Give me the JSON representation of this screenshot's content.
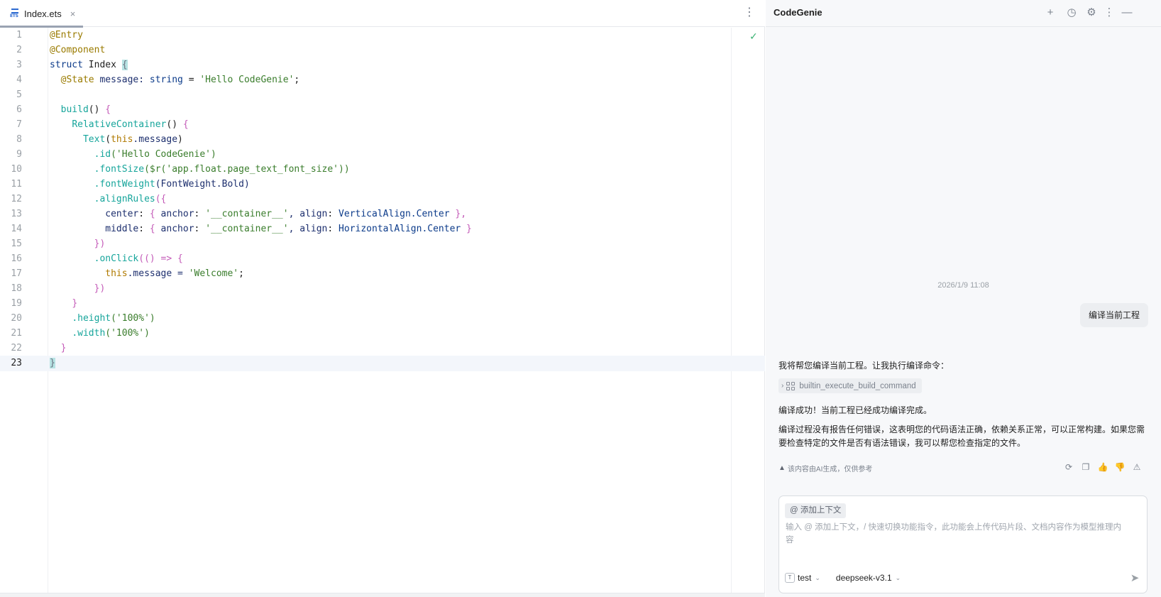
{
  "editor": {
    "tab": {
      "name": "Index.ets",
      "close": "×",
      "icon_label": "ETS"
    },
    "menu_icon": "⋮",
    "status_icon": "✓",
    "lines": [
      {
        "n": "1"
      },
      {
        "n": "2"
      },
      {
        "n": "3"
      },
      {
        "n": "4"
      },
      {
        "n": "5"
      },
      {
        "n": "6"
      },
      {
        "n": "7"
      },
      {
        "n": "8"
      },
      {
        "n": "9"
      },
      {
        "n": "10"
      },
      {
        "n": "11"
      },
      {
        "n": "12"
      },
      {
        "n": "13"
      },
      {
        "n": "14"
      },
      {
        "n": "15"
      },
      {
        "n": "16"
      },
      {
        "n": "17"
      },
      {
        "n": "18"
      },
      {
        "n": "19"
      },
      {
        "n": "20"
      },
      {
        "n": "21"
      },
      {
        "n": "22"
      },
      {
        "n": "23"
      }
    ],
    "code": {
      "l1": "@Entry",
      "l2": "@Component",
      "l3_kw": "struct",
      "l3_name": " Index ",
      "l3_brace": "{",
      "l4_ann": "@State",
      "l4_rest": " message: ",
      "l4_type": "string",
      "l4_eq": " = ",
      "l4_str": "'Hello CodeGenie'",
      "l4_end": ";",
      "l6_fn": "build",
      "l6_paren": "()",
      "l6_brace": " {",
      "l7_fn": "RelativeContainer",
      "l7_paren": "()",
      "l7_brace": " {",
      "l8_fn": "Text",
      "l8_open": "(",
      "l8_this": "this",
      "l8_rest": ".message",
      "l8_close": ")",
      "l9_fn": ".id",
      "l9_str": "('Hello CodeGenie')",
      "l10_fn": ".fontSize",
      "l10_arg": "($r('app.float.page_text_font_size'))",
      "l11_fn": ".fontWeight",
      "l11_arg": "(FontWeight.Bold)",
      "l12_fn": ".alignRules",
      "l12_arg": "({",
      "l13_a": "center",
      "l13_b": ": ",
      "l13_c": "{",
      "l13_d": " anchor",
      "l13_e": ": ",
      "l13_f": "'__container__'",
      "l13_g": ", align",
      "l13_h": ": ",
      "l13_i": "VerticalAlign.Center",
      "l13_j": " },",
      "l14_a": "middle",
      "l14_b": ": ",
      "l14_c": "{",
      "l14_d": " anchor",
      "l14_e": ": ",
      "l14_f": "'__container__'",
      "l14_g": ", align",
      "l14_h": ": ",
      "l14_i": "HorizontalAlign.Center",
      "l14_j": " }",
      "l15": "})",
      "l16_fn": ".onClick",
      "l16_arg": "(() => {",
      "l17_this": "this",
      "l17_rest": ".message = ",
      "l17_str": "'Welcome'",
      "l17_end": ";",
      "l18": "})",
      "l19": "}",
      "l20_fn": ".height",
      "l20_arg": "('100%')",
      "l21_fn": ".width",
      "l21_arg": "('100%')",
      "l22": "}",
      "l23": "}"
    }
  },
  "chat": {
    "title": "CodeGenie",
    "header_icons": {
      "new": "+",
      "history": "◷",
      "settings": "⚙",
      "more": "⋮",
      "minimize": "—"
    },
    "timestamp": "2026/1/9 11:08",
    "user_message": "编译当前工程",
    "ai_intro": "我将帮您编译当前工程。让我执行编译命令：",
    "tool_call": "builtin_execute_build_command",
    "ai_result": "编译成功！当前工程已经成功编译完成。",
    "ai_detail_1": "编译过程没有报告任何错误，这表明您的代码语法正确，依赖关系正常，可以正常构建。如果您需",
    "ai_detail_2": "要检查特定的文件是否有语法错误，我可以帮您检查指定的文件。",
    "disclaimer": "该内容由AI生成，仅供参考",
    "actions": {
      "regenerate": "⟳",
      "copy": "❐",
      "like": "👍",
      "dislike": "👎",
      "report": "⚠"
    },
    "composer": {
      "context_chip": "@ 添加上下文",
      "placeholder_1": "输入 @ 添加上下文，/ 快速切换功能指令，此功能会上传代码片段、文档内容作为模型推理内",
      "placeholder_2": "容",
      "agent": "test",
      "agent_badge": "T",
      "model": "deepseek-v3.1",
      "send": "➤"
    }
  }
}
